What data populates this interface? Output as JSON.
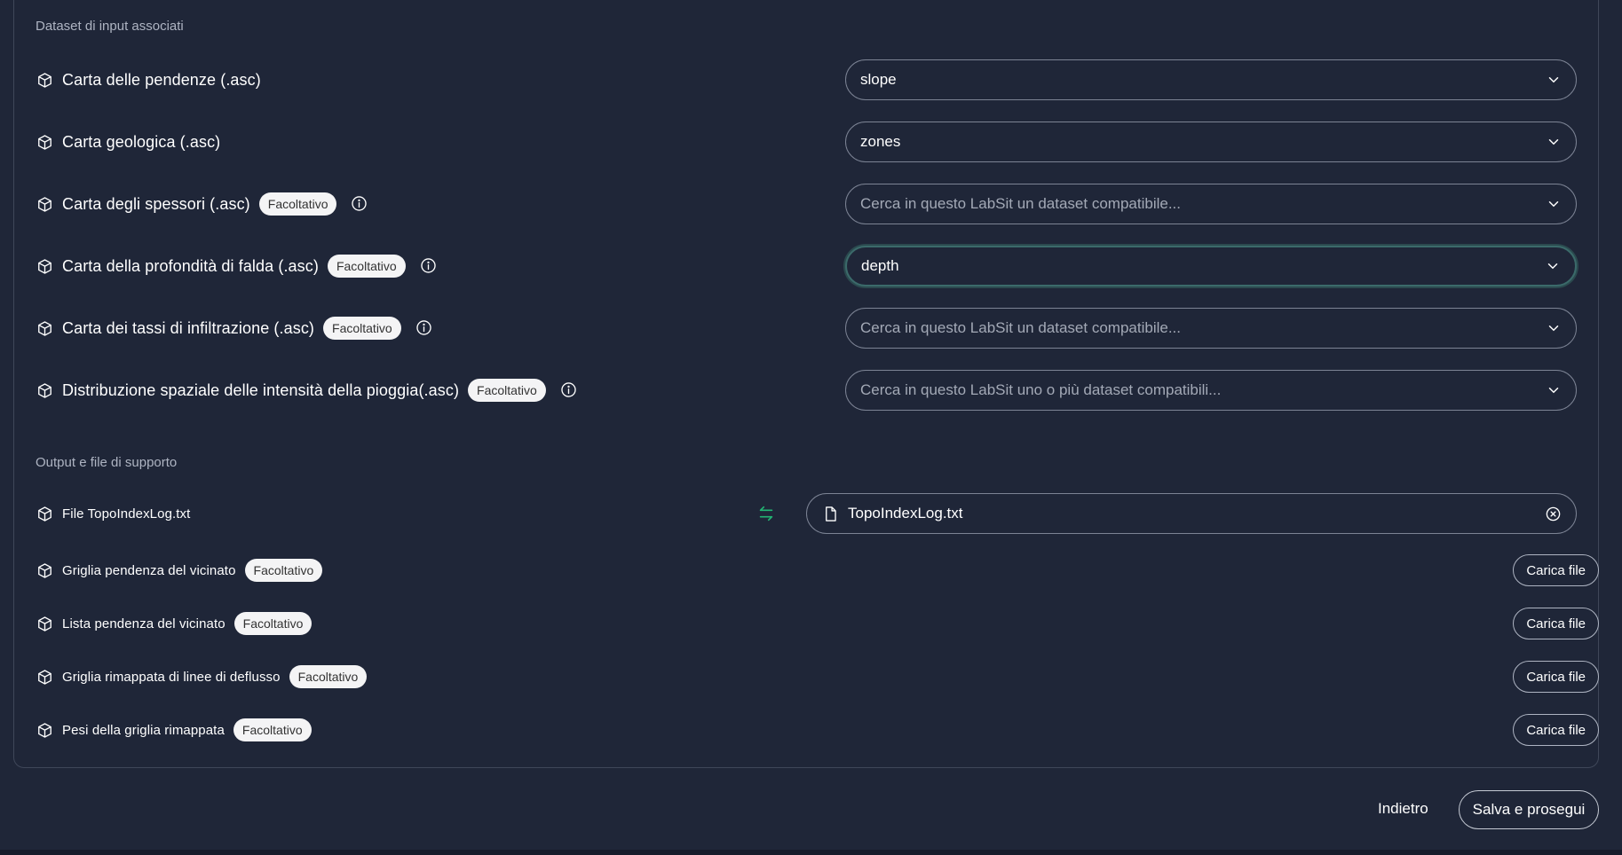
{
  "inputs_section": {
    "title": "Dataset di input associati",
    "rows": [
      {
        "label": "Carta delle pendenze (.asc)",
        "value": "slope"
      },
      {
        "label": "Carta geologica (.asc)",
        "value": "zones"
      },
      {
        "label": "Carta degli spessori (.asc)",
        "badge": "Facoltativo",
        "placeholder": "Cerca in questo LabSit un dataset compatibile..."
      },
      {
        "label": "Carta della profondità di falda (.asc)",
        "badge": "Facoltativo",
        "value": "depth"
      },
      {
        "label": "Carta dei tassi di infiltrazione (.asc)",
        "badge": "Facoltativo",
        "placeholder": "Cerca in questo LabSit un dataset compatibile..."
      },
      {
        "label": "Distribuzione spaziale delle intensità della pioggia(.asc)",
        "badge": "Facoltativo",
        "placeholder": "Cerca in questo LabSit uno o più dataset compatibili..."
      }
    ]
  },
  "outputs_section": {
    "title": "Output e file di supporto",
    "file_row": {
      "label": "File TopoIndexLog.txt",
      "filename": "TopoIndexLog.txt"
    },
    "upload_rows": [
      {
        "label": "Griglia pendenza del vicinato",
        "badge": "Facoltativo",
        "button": "Carica file"
      },
      {
        "label": "Lista pendenza del vicinato",
        "badge": "Facoltativo",
        "button": "Carica file"
      },
      {
        "label": "Griglia rimappata di linee di deflusso",
        "badge": "Facoltativo",
        "button": "Carica file"
      },
      {
        "label": "Pesi della griglia rimappata",
        "badge": "Facoltativo",
        "button": "Carica file"
      }
    ]
  },
  "footer": {
    "back_label": "Indietro",
    "save_label": "Salva e prosegui"
  },
  "colors": {
    "background": "#1f2638",
    "accent_green": "#22b573",
    "focus_border": "#3b6a6a"
  }
}
